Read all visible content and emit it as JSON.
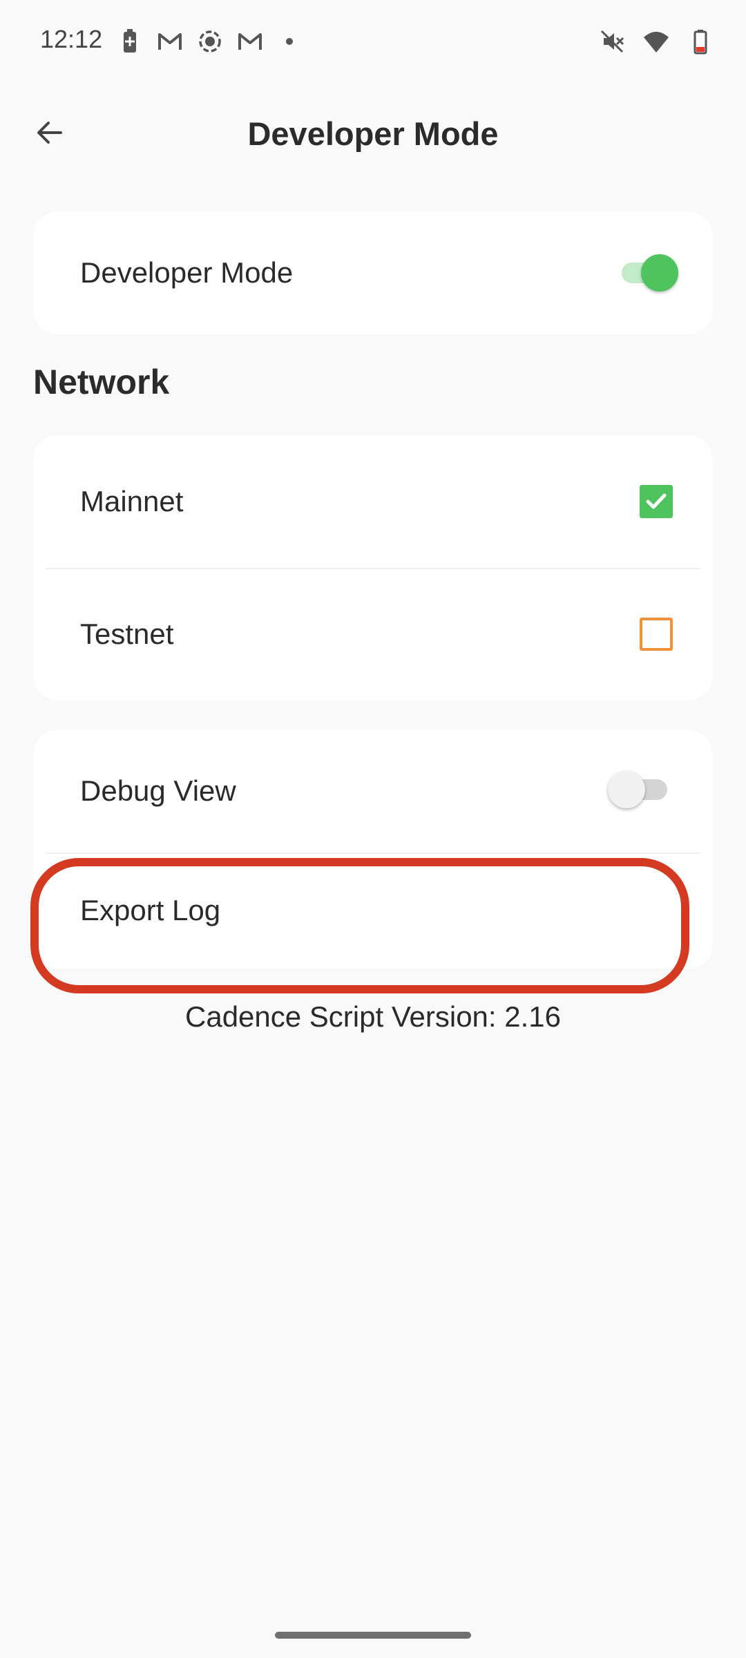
{
  "status_bar": {
    "time": "12:12",
    "left_icons": [
      "battery-saver-icon",
      "gmail-icon",
      "screen-record-icon",
      "gmail-icon",
      "notification-dot-icon"
    ],
    "right_icons": [
      "mute-icon",
      "wifi-icon",
      "battery-low-icon"
    ]
  },
  "app_bar": {
    "title": "Developer Mode",
    "back_icon": "arrow-left-icon"
  },
  "developer_mode": {
    "label": "Developer Mode",
    "enabled": true
  },
  "network": {
    "section_title": "Network",
    "options": [
      {
        "label": "Mainnet",
        "checked": true
      },
      {
        "label": "Testnet",
        "checked": false
      }
    ]
  },
  "debug": {
    "debug_view_label": "Debug View",
    "debug_view_enabled": false,
    "export_log_label": "Export Log"
  },
  "footer": {
    "version_text": "Cadence Script Version: 2.16"
  },
  "colors": {
    "accent_green": "#4fc45e",
    "checkbox_orange": "#f0923a",
    "highlight_red": "#d43a22",
    "background": "#f9f9f9"
  }
}
